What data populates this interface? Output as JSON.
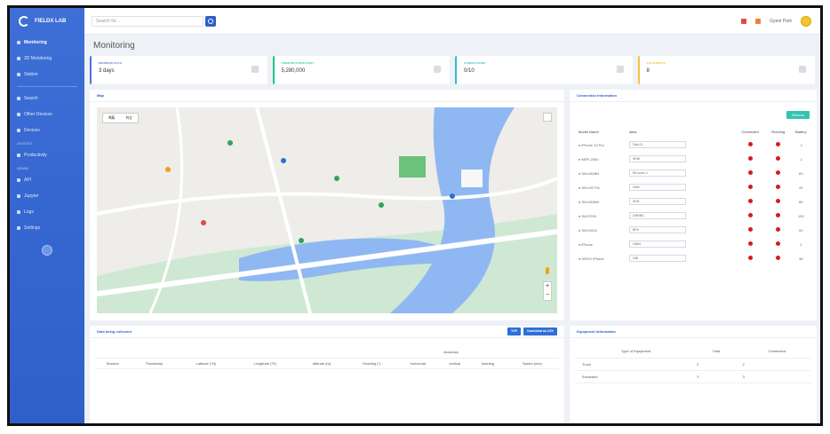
{
  "brand": {
    "name": "FIELDX LAB"
  },
  "sidebar": {
    "items": [
      {
        "label": "Monitoring",
        "active": true
      },
      {
        "label": "3D Monitoring"
      },
      {
        "label": "Station"
      },
      {
        "label": "Search"
      },
      {
        "label": "Other Devices"
      },
      {
        "label": "Devices"
      },
      {
        "label": "Productivity"
      },
      {
        "label": "API"
      },
      {
        "label": "Jupyter"
      },
      {
        "label": "Logs"
      },
      {
        "label": "Settings"
      }
    ],
    "captions": [
      "",
      "DEVICES",
      "ADMIN"
    ]
  },
  "topbar": {
    "search_placeholder": "Search for...",
    "user": "Gyeol Park"
  },
  "page": {
    "title": "Monitoring"
  },
  "stats": [
    {
      "label": "WORKING DAYS",
      "value": "3 days",
      "color": "#4e73df"
    },
    {
      "label": "CONSTRUCTION COST",
      "value": "5,280,000",
      "color": "#1cc88a"
    },
    {
      "label": "CONNECTIONS",
      "value": "0/10",
      "color": "#36b9cc"
    },
    {
      "label": "EQUIPMENTS",
      "value": "8",
      "color": "#f6c23e"
    }
  ],
  "map": {
    "title": "Map",
    "toggle": [
      "지도",
      "위성"
    ]
  },
  "connection": {
    "title": "Connection Information",
    "refresh": "Refresh",
    "headers": [
      "Model Name",
      "Alias",
      "Connected",
      "Running",
      "Battery"
    ],
    "rows": [
      {
        "model": "iPhone 12 Pro",
        "alias": "Test-01",
        "battery": "-1"
      },
      {
        "model": "MRF-2000",
        "alias": "SHW",
        "battery": "-1"
      },
      {
        "model": "SM-A528N",
        "alias": "SN-rover-1",
        "battery": "83"
      },
      {
        "model": "SM-G977N",
        "alias": "16hh",
        "battery": "25"
      },
      {
        "model": "SM-A530N",
        "alias": "SOH",
        "battery": "89"
      },
      {
        "model": "SM-F200",
        "alias": "CMNBS",
        "battery": "100"
      },
      {
        "model": "SM-G013",
        "alias": "BHh",
        "battery": "93"
      },
      {
        "model": "iPhone",
        "alias": "CMbs",
        "battery": "1"
      },
      {
        "model": "HERO iPhone",
        "alias": "CMl",
        "battery": "38"
      }
    ]
  },
  "data_table": {
    "title": "Data being collected",
    "buttons": [
      "TOP",
      "Download as CSV"
    ],
    "group_header": "Accuracy",
    "headers": [
      "Session",
      "Timestamp",
      "Latitude (°N)",
      "Longitude (°E)",
      "Altitude (m)",
      "Heading (°)",
      "horizontal",
      "vertical",
      "heading",
      "Speed (m/s)"
    ]
  },
  "equipment": {
    "title": "Equipment Information",
    "headers": [
      "Type of Equipment",
      "Total",
      "Connected"
    ],
    "rows": [
      {
        "type": "Truck",
        "total": "2",
        "connected": "2"
      },
      {
        "type": "Excavator",
        "total": "3",
        "connected": "3"
      }
    ]
  }
}
